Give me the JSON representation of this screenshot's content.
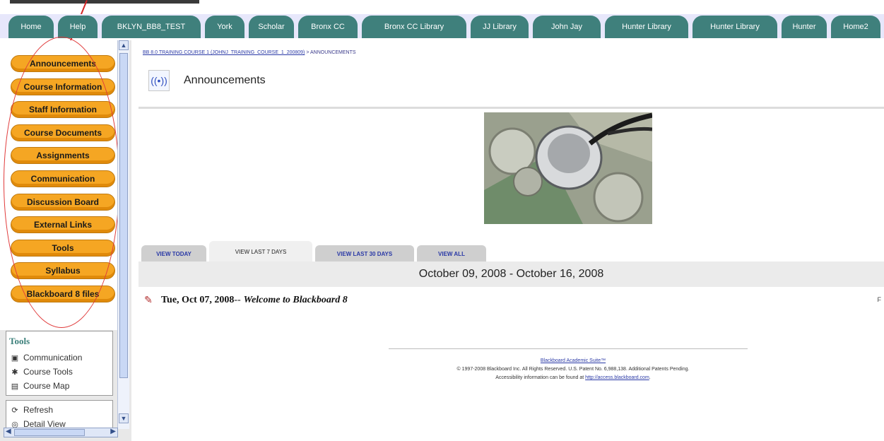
{
  "top_tabs": [
    "Home",
    "Help",
    "BKLYN_BB8_TEST",
    "York",
    "Scholar",
    "Bronx CC",
    "Bronx CC Library",
    "JJ Library",
    "John Jay",
    "Hunter Library",
    "Hunter Library",
    "Hunter",
    "Home2"
  ],
  "course_menu": [
    "Announcements",
    "Course Information",
    "Staff Information",
    "Course Documents",
    "Assignments",
    "Communication",
    "Discussion Board",
    "External Links",
    "Tools",
    "Syllabus",
    "Blackboard 8 files"
  ],
  "tools_panel": {
    "title": "Tools",
    "items": [
      {
        "label": "Communication",
        "icon": "communication-icon"
      },
      {
        "label": "Course Tools",
        "icon": "course-tools-icon"
      },
      {
        "label": "Course Map",
        "icon": "course-map-icon"
      }
    ],
    "items2": [
      {
        "label": "Refresh",
        "icon": "refresh-icon"
      },
      {
        "label": "Detail View",
        "icon": "detail-view-icon"
      }
    ]
  },
  "breadcrumb": {
    "course_link": "BB 8.0 TRAINING COURSE 1 (JOHNJ_TRAINING_COURSE_1_200809)",
    "separator": " > ",
    "current": "ANNOUNCEMENTS"
  },
  "page_title": "Announcements",
  "view_tabs": [
    {
      "label": "VIEW TODAY",
      "active": false
    },
    {
      "label": "VIEW LAST 7 DAYS",
      "active": true
    },
    {
      "label": "VIEW LAST 30 DAYS",
      "active": false
    },
    {
      "label": "VIEW ALL",
      "active": false
    }
  ],
  "date_range": "October 09, 2008 - October 16, 2008",
  "announcement": {
    "date": "Tue, Oct 07, 2008",
    "separator": " -- ",
    "subject": "Welcome to Blackboard 8"
  },
  "right_edge_mark": "F",
  "footer": {
    "suite_link": "Blackboard Academic Suite™",
    "copyright": "© 1997-2008 Blackboard Inc. All Rights Reserved. U.S. Patent No. 6,988,138. Additional Patents Pending.",
    "accessibility_prefix": "Accessibility information can be found at ",
    "accessibility_link": "http://access.blackboard.com",
    "accessibility_suffix": "."
  },
  "colors": {
    "tab_teal": "#3f807c",
    "tab_bar_bg": "#e7e7fb",
    "menu_orange": "#f5a623",
    "link_blue": "#2a39a6",
    "annotation_red": "#e03a3a"
  }
}
